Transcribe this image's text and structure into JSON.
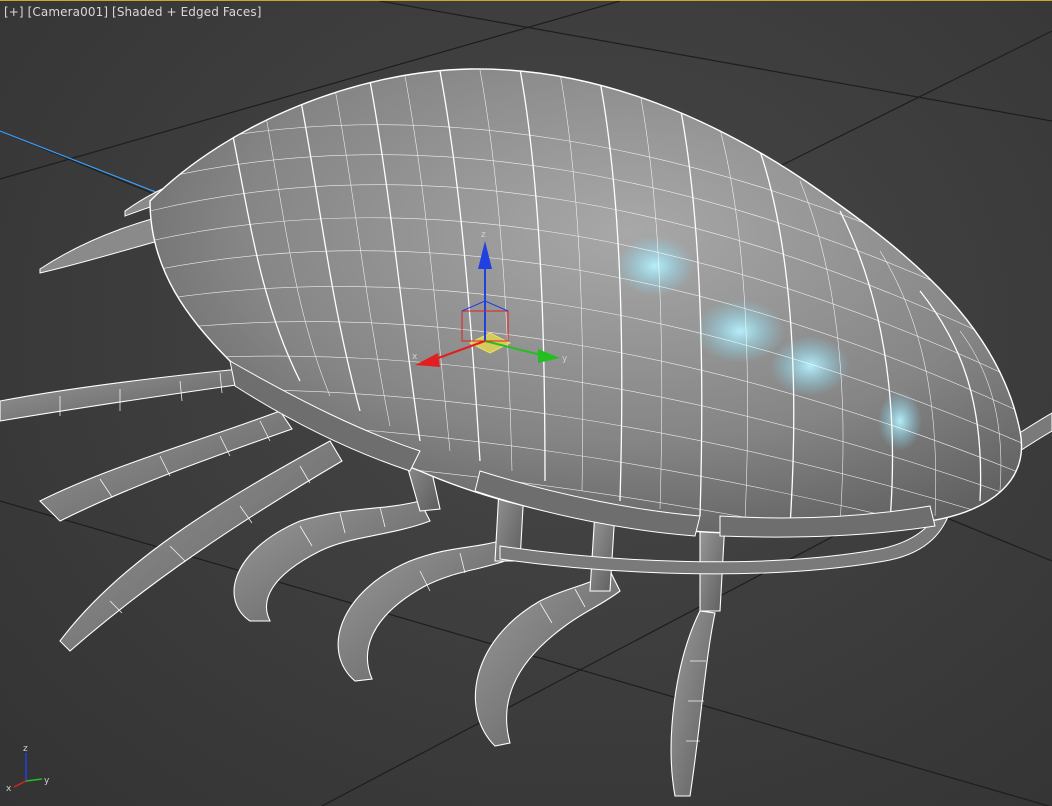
{
  "viewport": {
    "label_plus": "[+]",
    "label_camera": "[Camera001]",
    "label_shading": "[Shaded + Edged Faces]"
  },
  "gizmo": {
    "x": "x",
    "y": "y",
    "z": "z"
  },
  "corner_axes": {
    "x": "x",
    "y": "y",
    "z": "z"
  },
  "colors": {
    "viewport_border": "#c8a82a",
    "background": "#3c3c3c",
    "grid": "#1e1e1e",
    "mesh_fill": "#8a8a8a",
    "wire": "#ffffff",
    "highlight": "#9fe8ff",
    "axis_x": "#e02020",
    "axis_y": "#20c020",
    "axis_z": "#2040e0",
    "camera_line": "#3aa0ff"
  }
}
